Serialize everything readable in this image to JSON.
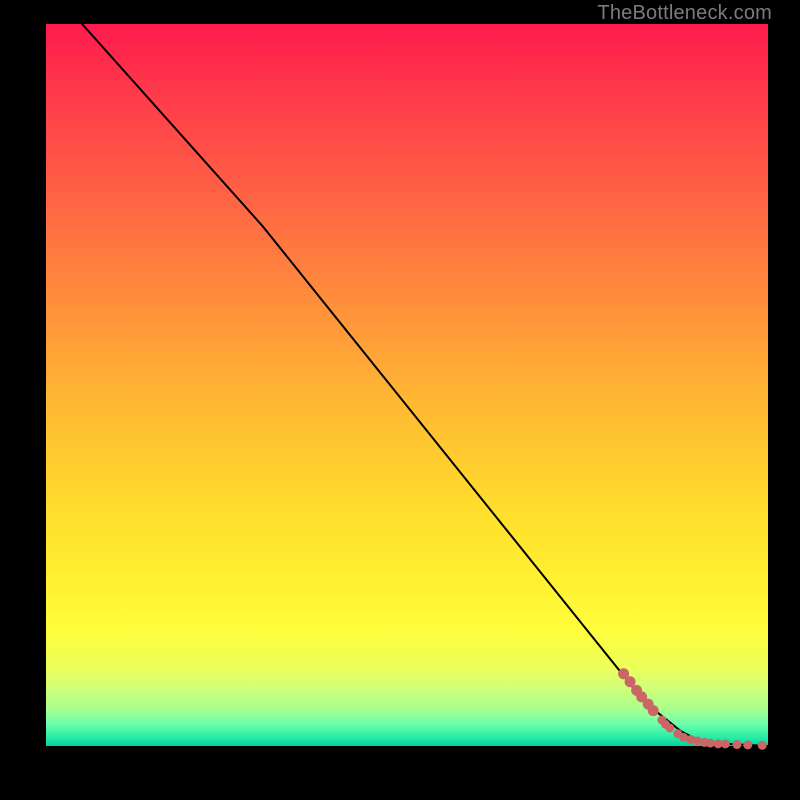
{
  "watermark": "TheBottleneck.com",
  "colors": {
    "background": "#000000",
    "line": "#000000",
    "marker_fill": "#cc6666",
    "marker_stroke": "#cc6666",
    "gradient_top": "#ff1a4d",
    "gradient_bottom": "#00d39a"
  },
  "chart_data": {
    "type": "line",
    "title": "",
    "xlabel": "",
    "ylabel": "",
    "xlim": [
      0,
      100
    ],
    "ylim": [
      0,
      100
    ],
    "grid": false,
    "series": [
      {
        "name": "curve",
        "type": "line",
        "x": [
          5,
          30,
          83,
          88,
          90,
          92,
          94,
          96,
          98,
          100
        ],
        "y": [
          100,
          72,
          6,
          2,
          1,
          0.5,
          0.3,
          0.2,
          0.1,
          0
        ]
      },
      {
        "name": "markers",
        "type": "scatter",
        "points": [
          {
            "x": 80.0,
            "y": 10.0,
            "r": 5
          },
          {
            "x": 80.9,
            "y": 8.9,
            "r": 5
          },
          {
            "x": 81.8,
            "y": 7.7,
            "r": 5
          },
          {
            "x": 82.5,
            "y": 6.8,
            "r": 5
          },
          {
            "x": 83.4,
            "y": 5.8,
            "r": 5
          },
          {
            "x": 84.1,
            "y": 4.9,
            "r": 5
          },
          {
            "x": 85.3,
            "y": 3.6,
            "r": 4
          },
          {
            "x": 85.8,
            "y": 3.0,
            "r": 4
          },
          {
            "x": 86.4,
            "y": 2.5,
            "r": 4
          },
          {
            "x": 87.5,
            "y": 1.7,
            "r": 4
          },
          {
            "x": 88.3,
            "y": 1.2,
            "r": 4
          },
          {
            "x": 89.3,
            "y": 0.9,
            "r": 4
          },
          {
            "x": 90.2,
            "y": 0.7,
            "r": 4
          },
          {
            "x": 91.2,
            "y": 0.5,
            "r": 4
          },
          {
            "x": 92.0,
            "y": 0.4,
            "r": 4
          },
          {
            "x": 93.1,
            "y": 0.3,
            "r": 4
          },
          {
            "x": 94.1,
            "y": 0.3,
            "r": 4
          },
          {
            "x": 95.7,
            "y": 0.2,
            "r": 4
          },
          {
            "x": 97.2,
            "y": 0.15,
            "r": 4
          },
          {
            "x": 99.2,
            "y": 0.1,
            "r": 4
          }
        ]
      }
    ]
  }
}
